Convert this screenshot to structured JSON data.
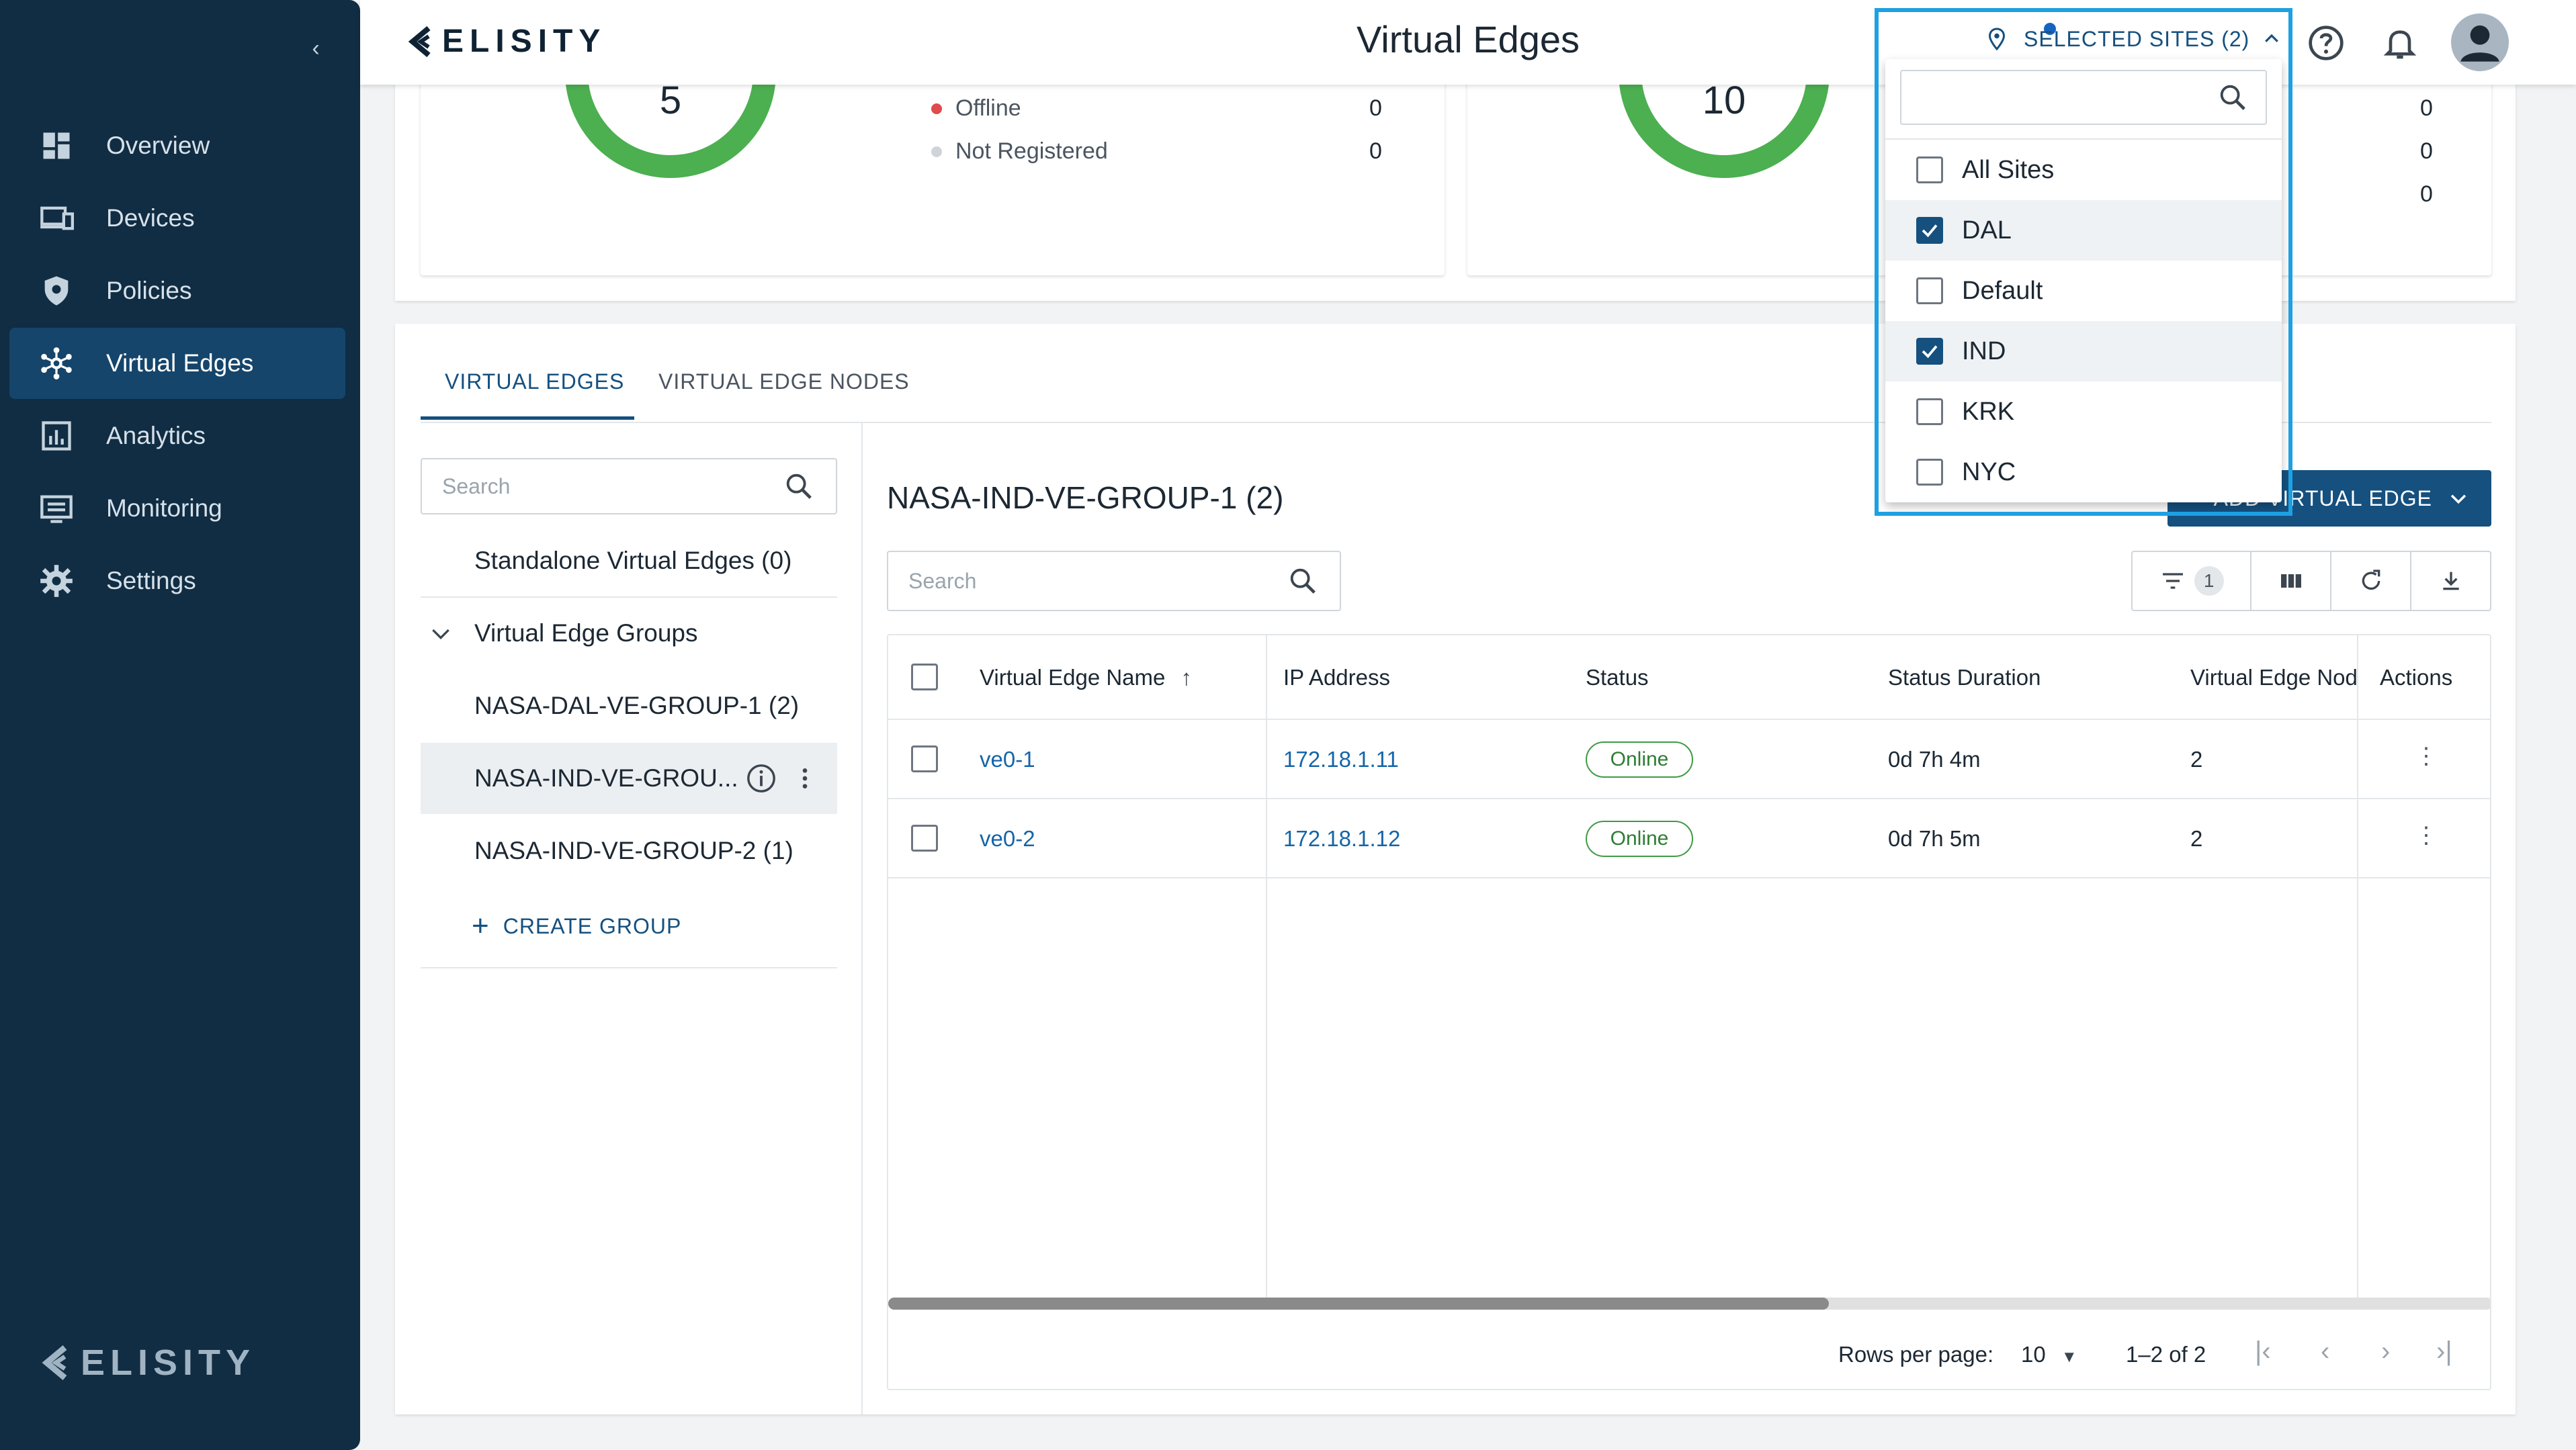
{
  "sidebar": {
    "items": [
      {
        "label": "Overview",
        "icon": "dashboard-icon"
      },
      {
        "label": "Devices",
        "icon": "devices-icon"
      },
      {
        "label": "Policies",
        "icon": "shield-icon"
      },
      {
        "label": "Virtual Edges",
        "icon": "network-hub-icon",
        "active": true
      },
      {
        "label": "Analytics",
        "icon": "analytics-icon"
      },
      {
        "label": "Monitoring",
        "icon": "monitor-icon"
      },
      {
        "label": "Settings",
        "icon": "gear-icon"
      }
    ],
    "logo_text": "ELISITY"
  },
  "header": {
    "logo_text": "ELISITY",
    "title": "Virtual Edges",
    "sites_label": "SELECTED SITES (2)"
  },
  "top_cards": [
    {
      "total": "5",
      "legend": [
        {
          "label": "Offline",
          "value": "0",
          "color": "#e04b4b"
        },
        {
          "label": "Not Registered",
          "value": "0",
          "color": "#d0d4d8"
        }
      ]
    },
    {
      "total": "10",
      "values": [
        "0",
        "0",
        "0"
      ]
    }
  ],
  "tabs": [
    {
      "label": "VIRTUAL EDGES",
      "active": true
    },
    {
      "label": "VIRTUAL EDGE NODES",
      "active": false
    }
  ],
  "left_pane": {
    "search_placeholder": "Search",
    "standalone": "Standalone Virtual Edges (0)",
    "groups_label": "Virtual Edge Groups",
    "groups": [
      {
        "label": "NASA-DAL-VE-GROUP-1 (2)",
        "selected": false
      },
      {
        "label": "NASA-IND-VE-GROU...",
        "selected": true
      },
      {
        "label": "NASA-IND-VE-GROUP-2 (1)",
        "selected": false
      }
    ],
    "create_group": "CREATE GROUP"
  },
  "main": {
    "group_title": "NASA-IND-VE-GROUP-1 (2)",
    "add_button": "ADD VIRTUAL EDGE",
    "search_placeholder": "Search",
    "filter_count": "1",
    "columns": [
      "Virtual Edge Name",
      "IP Address",
      "Status",
      "Status Duration",
      "Virtual Edge Nod",
      "Actions"
    ],
    "rows": [
      {
        "name": "ve0-1",
        "ip": "172.18.1.11",
        "status": "Online",
        "duration": "0d 7h 4m",
        "nodes": "2"
      },
      {
        "name": "ve0-2",
        "ip": "172.18.1.12",
        "status": "Online",
        "duration": "0d 7h 5m",
        "nodes": "2"
      }
    ],
    "pagination": {
      "rows_per_page_label": "Rows per page:",
      "rows_per_page": "10",
      "range": "1–2 of 2"
    }
  },
  "sites_dropdown": {
    "search_value": "",
    "options": [
      {
        "label": "All Sites",
        "checked": false
      },
      {
        "label": "DAL",
        "checked": true
      },
      {
        "label": "Default",
        "checked": false
      },
      {
        "label": "IND",
        "checked": true
      },
      {
        "label": "KRK",
        "checked": false
      },
      {
        "label": "NYC",
        "checked": false
      }
    ]
  },
  "colors": {
    "sidebar_bg": "#112d43",
    "primary": "#15507f",
    "online": "#3f9b45",
    "highlight": "#1ea0e2"
  }
}
